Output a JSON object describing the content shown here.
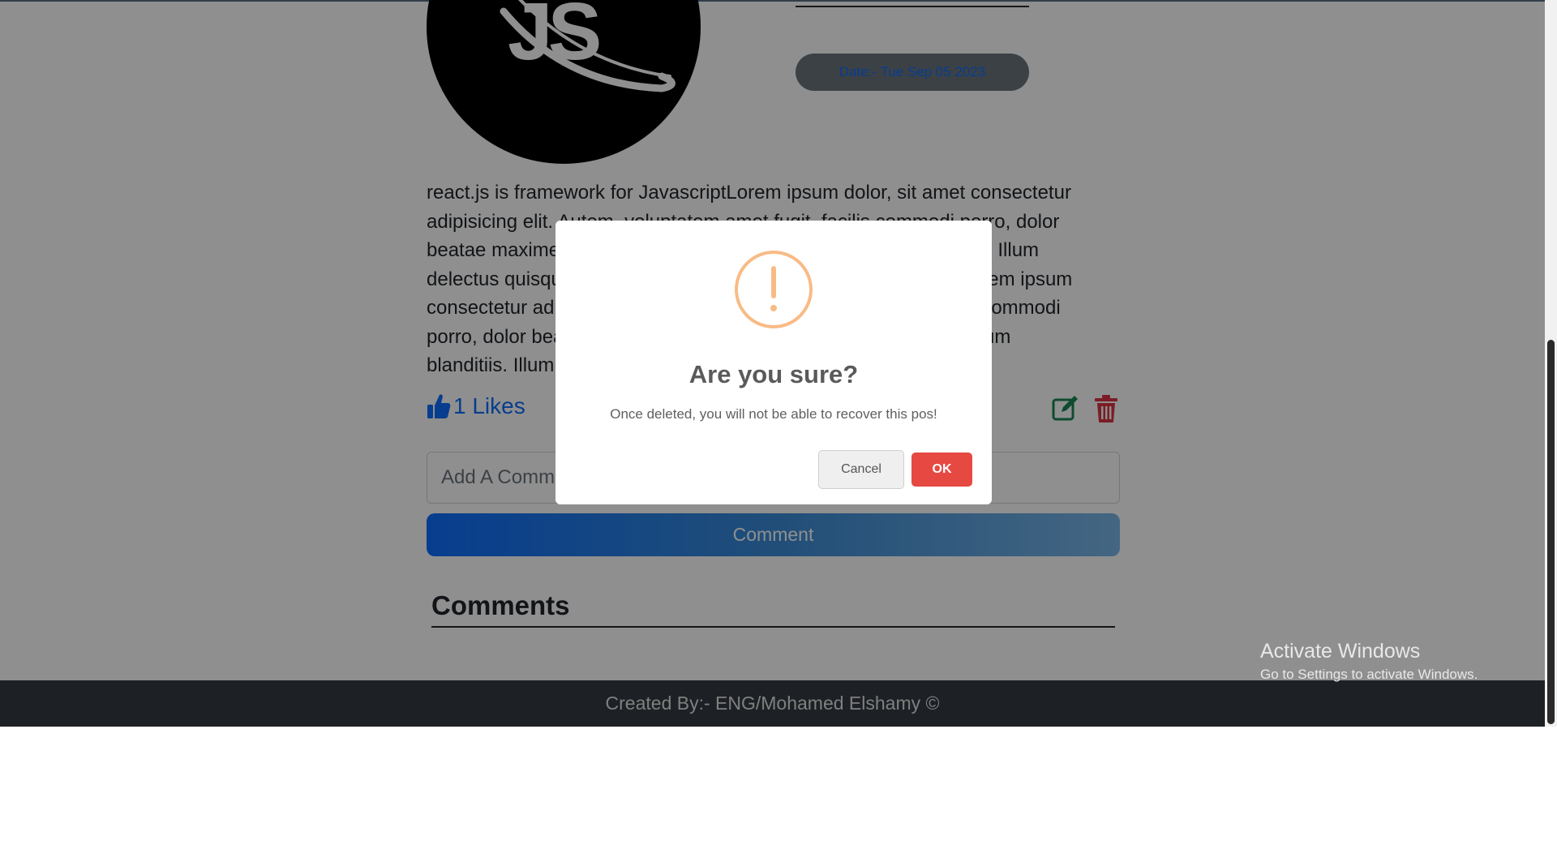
{
  "post": {
    "image_alt_text": "JS",
    "date_label": "Date:- Tue Sep 05 2023",
    "body": "react.js is framework for JavascriptLorem ipsum dolor, sit amet consectetur adipisicing elit. Autem, voluptatem amet fugit, facilis commodi porro, dolor beatae maxime eligendi consequatur sit dolorem earum blanditiis. Illum delectus quisquam? Enim. react.js is framework for JavascriptLorem ipsum consectetur adipisicing elit. Autem, voluptatem amet fugit, facilis commodi porro, dolor beatae maxime eligendi consequatur sit dolorem earum blanditiis. Illum delectus quisquam? Enim.",
    "likes_label": "1 Likes",
    "edit_icon": "edit-icon",
    "delete_icon": "trash-icon"
  },
  "comment_form": {
    "placeholder": "Add A Comment",
    "submit_label": "Comment"
  },
  "comments_section": {
    "heading": "Comments"
  },
  "footer": {
    "credit": "Created By:- ENG/Mohamed Elshamy ©"
  },
  "windows_watermark": {
    "title": "Activate Windows",
    "subtitle": "Go to Settings to activate Windows."
  },
  "dialog": {
    "icon": "warning-icon",
    "title": "Are you sure?",
    "text": "Once deleted, you will not be able to recover this pos!",
    "cancel_label": "Cancel",
    "ok_label": "OK"
  },
  "colors": {
    "primary": "#0d6efd",
    "danger": "#dc3545",
    "success": "#198754",
    "warning": "#f8bb86",
    "ok_button": "#e64942",
    "footer_bg": "#343a40"
  }
}
